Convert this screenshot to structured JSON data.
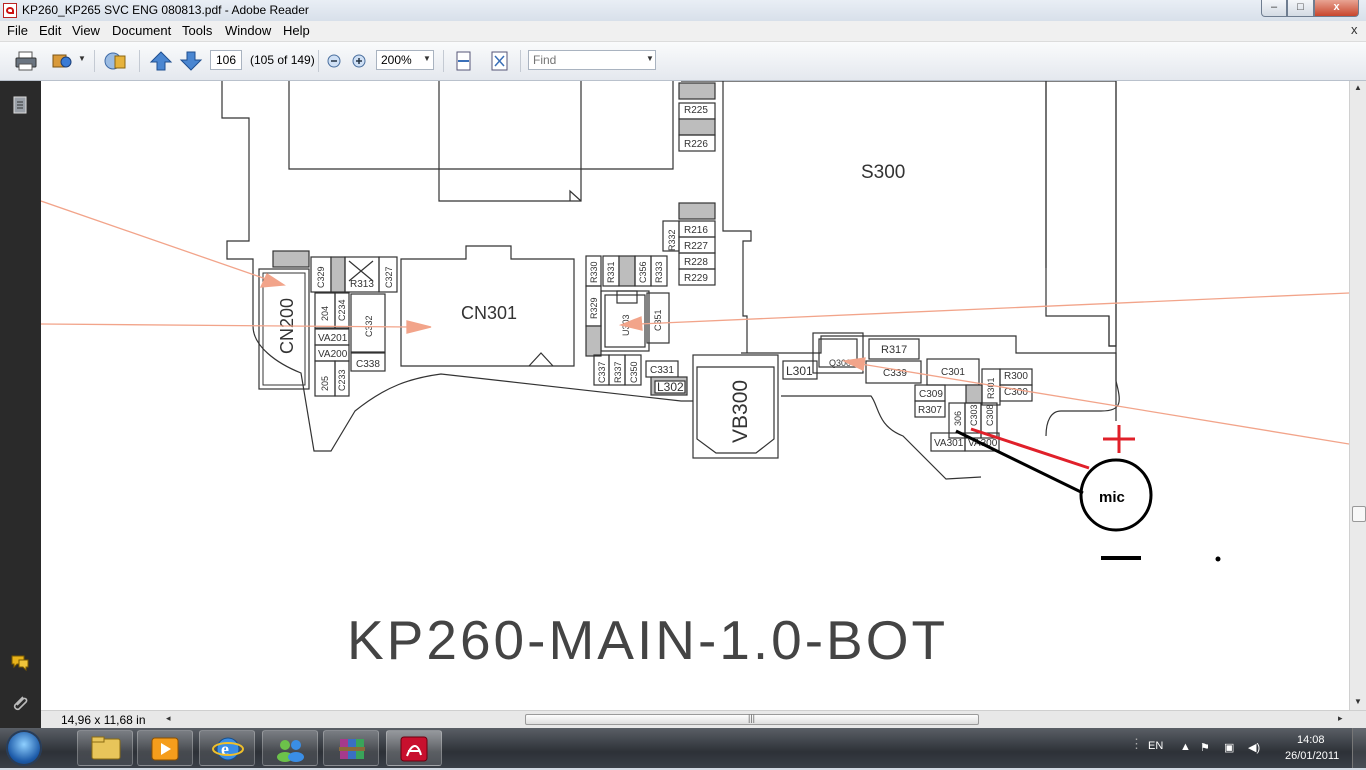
{
  "window": {
    "title": "KP260_KP265 SVC ENG 080813.pdf - Adobe Reader",
    "minimize_label": "–",
    "maximize_label": "□",
    "close_label": "x"
  },
  "menu": {
    "items": [
      "File",
      "Edit",
      "View",
      "Document",
      "Tools",
      "Window",
      "Help"
    ],
    "close_doc_label": "x"
  },
  "toolbar": {
    "page_number": "106",
    "page_count": "(105 of 149)",
    "zoom": "200%",
    "find_placeholder": "Find"
  },
  "document": {
    "schematic_title": "KP260-MAIN-1.0-BOT",
    "components": {
      "S300": "S300",
      "CN200": "CN200",
      "CN301": "CN301",
      "VB300": "VB300",
      "R225": "R225",
      "R226": "R226",
      "R216": "R216",
      "R227": "R227",
      "R228": "R228",
      "R229": "R229",
      "R332": "R332",
      "R330": "R330",
      "R331": "R331",
      "C356": "C356",
      "R333": "R333",
      "R329": "R329",
      "U303": "U303",
      "C351": "C351",
      "C337": "C337",
      "R337": "R337",
      "C350": "C350",
      "C331": "C331",
      "L302": "L302",
      "L301": "L301",
      "Q300": "Q300",
      "R317": "R317",
      "C339": "C339",
      "C301": "C301",
      "C309": "C309",
      "R307": "R307",
      "R306": "306",
      "C303": "C303",
      "C308": "C308",
      "R301": "R301",
      "R300": "R300",
      "C300": "C300",
      "VA301": "VA301",
      "VA300": "VA300",
      "C329": "C329",
      "R313": "R313",
      "C327": "C327",
      "C204": "204",
      "C234": "C234",
      "C332": "C332",
      "VA201": "VA201",
      "VA200": "VA200",
      "C205": "205",
      "C233": "C233",
      "C338": "C338"
    },
    "annotations": {
      "mic_label": "mic",
      "plus_label": "+",
      "minus_label": "−"
    }
  },
  "statusbar": {
    "page_size": "14,96 x 11,68 in"
  },
  "taskbar": {
    "language": "EN",
    "time": "14:08",
    "date": "26/01/2011"
  },
  "colors": {
    "arrow_salmon": "#f2a48a",
    "wire_red": "#e0202a",
    "wire_black": "#000000",
    "nav_panel": "#2a2a2a"
  }
}
